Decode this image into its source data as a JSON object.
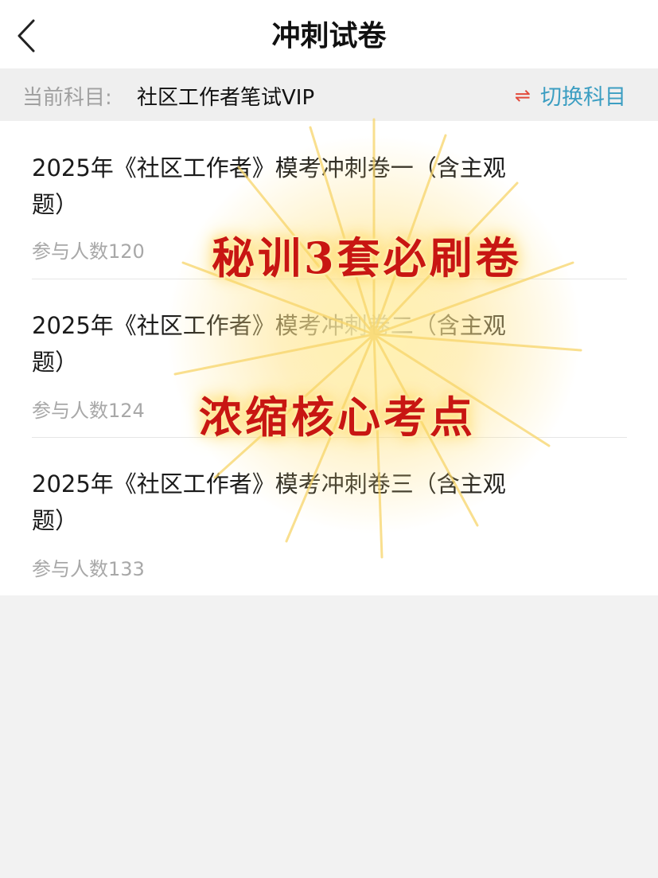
{
  "header": {
    "title": "冲刺试卷"
  },
  "subject": {
    "label": "当前科目:",
    "value": "社区工作者笔试VIP",
    "switch_icon": "⇌",
    "switch_label": "切换科目"
  },
  "papers": [
    {
      "title": "2025年《社区工作者》模考冲刺卷一（含主观题）",
      "count": "参与人数120"
    },
    {
      "title": "2025年《社区工作者》模考冲刺卷二（含主观题）",
      "count": "参与人数124"
    },
    {
      "title": "2025年《社区工作者》模考冲刺卷三（含主观题）",
      "count": "参与人数133"
    }
  ],
  "overlay": {
    "slogan_1": "秘训3套必刷卷",
    "slogan_2": "浓缩核心考点"
  },
  "colors": {
    "accent_link": "#3c9ec2",
    "switch_icon": "#e24a3b",
    "slogan": "#c81612",
    "glow": "#ffd24a"
  }
}
